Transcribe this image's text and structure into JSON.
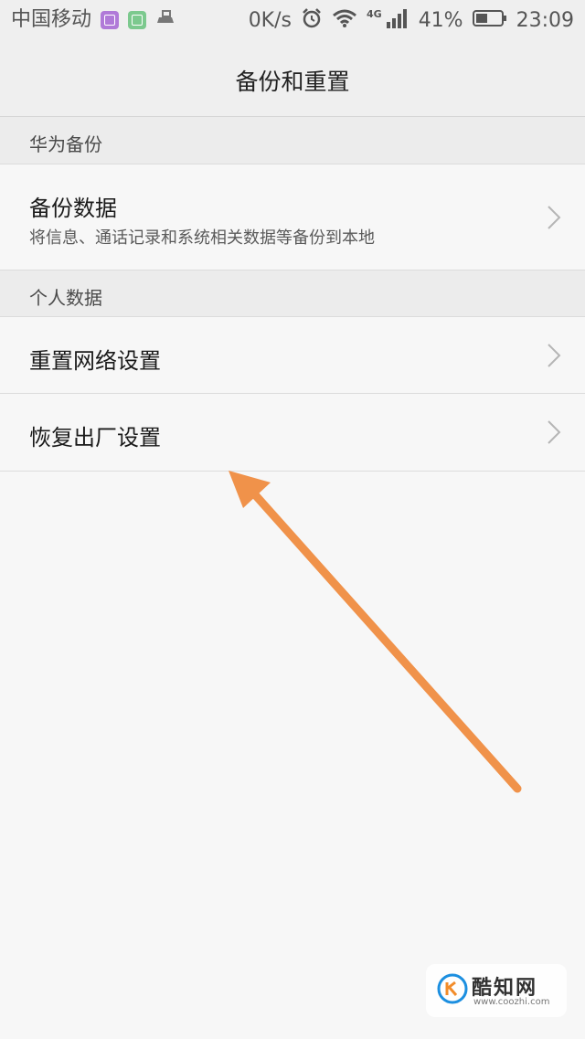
{
  "status_bar": {
    "carrier": "中国移动",
    "speed": "0K/s",
    "network_badge": "4G",
    "battery": "41%",
    "time": "23:09"
  },
  "header": {
    "title": "备份和重置"
  },
  "sections": [
    {
      "label": "华为备份",
      "items": [
        {
          "title": "备份数据",
          "subtitle": "将信息、通话记录和系统相关数据等备份到本地"
        }
      ]
    },
    {
      "label": "个人数据",
      "items": [
        {
          "title": "重置网络设置"
        },
        {
          "title": "恢复出厂设置"
        }
      ]
    }
  ],
  "annotation": {
    "arrow_color": "#f0924a"
  },
  "watermark": {
    "name": "酷知网",
    "url": "www.coozhi.com"
  }
}
